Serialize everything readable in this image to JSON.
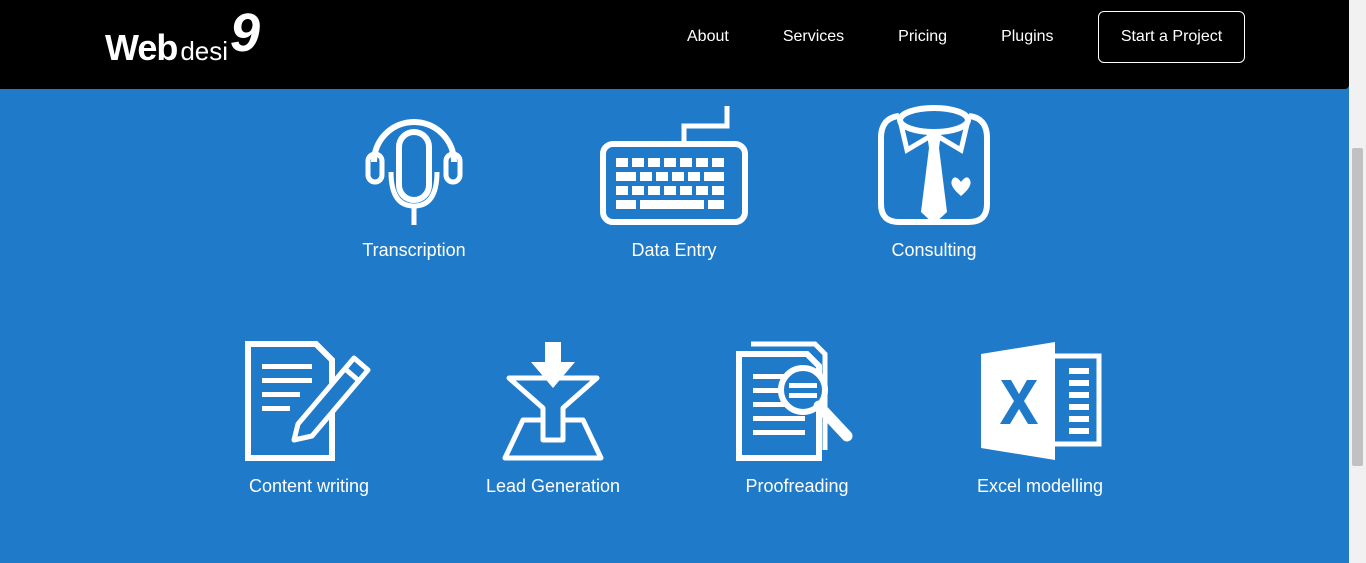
{
  "brand": {
    "web": "Web",
    "desi": "desi",
    "nine": "9"
  },
  "nav": {
    "items": [
      {
        "label": "About"
      },
      {
        "label": "Services"
      },
      {
        "label": "Pricing"
      },
      {
        "label": "Plugins"
      }
    ],
    "cta_label": "Start a Project"
  },
  "services": [
    {
      "label": "Transcription",
      "icon": "headset-microphone-icon"
    },
    {
      "label": "Data Entry",
      "icon": "keyboard-icon"
    },
    {
      "label": "Consulting",
      "icon": "shirt-tie-icon"
    },
    {
      "label": "Content writing",
      "icon": "document-pencil-icon"
    },
    {
      "label": "Lead Generation",
      "icon": "funnel-icon"
    },
    {
      "label": "Proofreading",
      "icon": "document-magnifier-icon"
    },
    {
      "label": "Excel modelling",
      "icon": "excel-icon"
    }
  ],
  "colors": {
    "background": "#1f7bc9",
    "navbar": "#000000",
    "text": "#ffffff"
  }
}
